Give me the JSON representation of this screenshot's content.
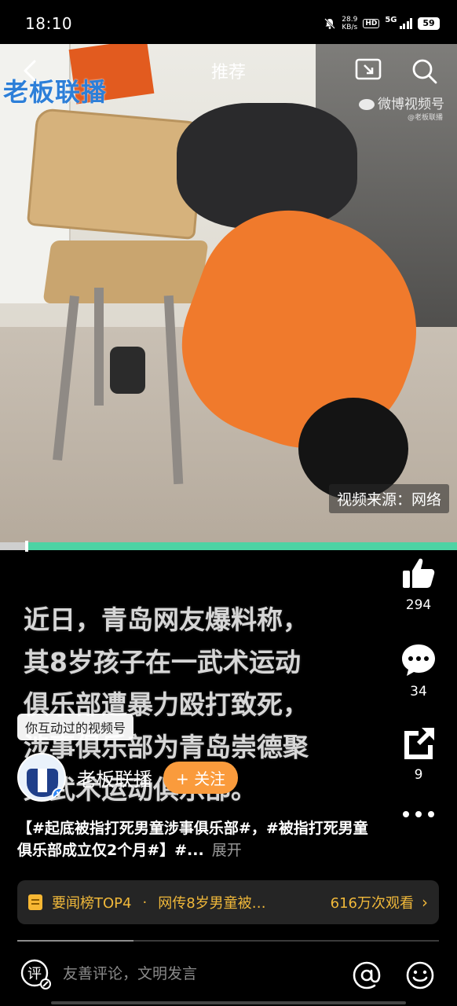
{
  "status_bar": {
    "time": "18:10",
    "net_speed_value": "28.9",
    "net_speed_unit": "KB/s",
    "hd_label": "HD",
    "network_label": "5G",
    "battery": "59"
  },
  "nav": {
    "title": "推荐",
    "icons": [
      "back-icon",
      "pip-icon",
      "search-icon"
    ]
  },
  "video": {
    "watermark_left": "老板联播",
    "watermark_right": "微博视频号",
    "watermark_right_sub": "@老板联播",
    "source_label": "视频来源：网络",
    "progress": 0.055
  },
  "caption": {
    "lines": [
      "近日，青岛网友爆料称，",
      "其8岁孩子在一武术运动",
      "俱乐部遭暴力殴打致死，",
      "涉事俱乐部为青岛崇德聚",
      "义武术运动俱乐部。"
    ]
  },
  "actions": {
    "like_count": "294",
    "comment_count": "34",
    "share_count": "9"
  },
  "interaction_tip": "你互动过的视频号",
  "author": {
    "name": "老板联播",
    "follow_label": "+ 关注",
    "verified_mark": "V"
  },
  "description": {
    "text": "【#起底被指打死男童涉事俱乐部#，#被指打死男童俱乐部成立仅2个月#】#...",
    "expand_label": "展开"
  },
  "hot_topic": {
    "rank_label": "要闻榜TOP4",
    "separator": "·",
    "title": "网传8岁男童被…",
    "views": "616万次观看",
    "arrow": "›"
  },
  "comment_bar": {
    "placeholder": "友善评论，文明发言"
  },
  "colors": {
    "accent_green": "#4dd3a4",
    "follow_orange": "#fa9b3c",
    "hot_gold": "#f0b83a",
    "verified_blue": "#2f86f6"
  }
}
